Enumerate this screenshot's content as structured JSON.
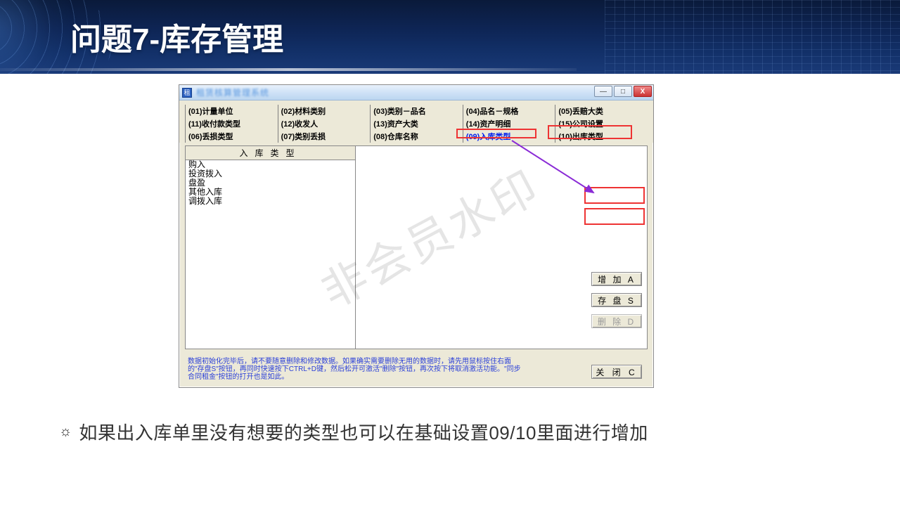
{
  "slide": {
    "title": "问题7-库存管理",
    "caption_bullet": "☼",
    "caption": "如果出入库单里没有想要的类型也可以在基础设置09/10里面进行增加"
  },
  "window": {
    "app_icon_text": "租",
    "app_title": "租赁核算管理系统",
    "min_glyph": "—",
    "max_glyph": "□",
    "close_glyph": "X"
  },
  "tabs": {
    "row1": [
      "(01)计量单位",
      "(02)材料类别",
      "(03)类别－品名",
      "(04)品名－规格",
      "(05)丢赔大类"
    ],
    "row2": [
      "(11)收付款类型",
      "(12)收发人",
      "(13)资产大类",
      "(14)资产明细",
      "(15)公司设置"
    ],
    "row3": [
      "(06)丢损类型",
      "(07)类别丢损",
      "(08)仓库名称",
      "(09)入库类型",
      "(10)出库类型"
    ],
    "active_index": [
      2,
      3
    ]
  },
  "list": {
    "header": "入库类型",
    "items": [
      "购入",
      "投资拨入",
      "盘盈",
      "其他入库",
      "调拨入库"
    ]
  },
  "buttons": {
    "add": "增 加 A",
    "save": "存 盘 S",
    "delete": "删 除 D",
    "close": "关 闭 C"
  },
  "footer": {
    "message": "数据初始化完毕后，请不要随意删除和修改数据。如果确实需要删除无用的数据时，请先用鼠标按住右面的\"存盘S\"按钮，再同时快速按下CTRL+D键，然后松开可激活\"删除\"按钮，再次按下将取消激活功能。\"同步合同租金\"按钮的打开也是如此。"
  },
  "watermark": "非会员水印"
}
